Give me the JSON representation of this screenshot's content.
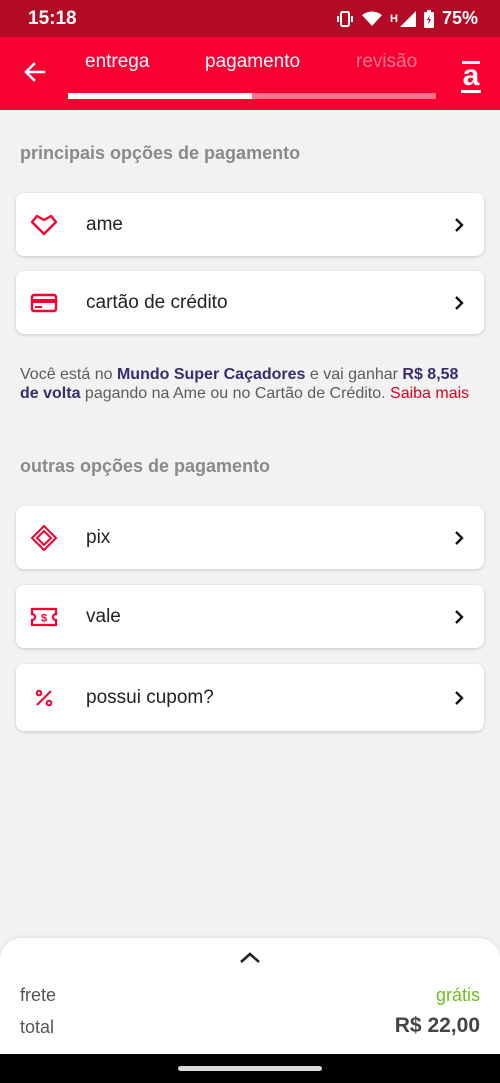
{
  "status_bar": {
    "time": "15:18",
    "network": "H",
    "battery": "75%"
  },
  "header": {
    "tabs": [
      {
        "label": "entrega"
      },
      {
        "label": "pagamento"
      },
      {
        "label": "revisão"
      }
    ],
    "progress": 0.5
  },
  "main_options": {
    "title": "principais opções de pagamento",
    "items": [
      {
        "label": "ame",
        "icon": "heart-diamond-icon"
      },
      {
        "label": "cartão de crédito",
        "icon": "credit-card-icon"
      }
    ]
  },
  "cashback": {
    "prefix": "Você está no ",
    "program": "Mundo Super Caçadores",
    "middle": " e vai ganhar ",
    "amount": "R$ 8,58 de volta",
    "suffix": " pagando na Ame ou no Cartão de Crédito. ",
    "link": "Saiba mais"
  },
  "other_options": {
    "title": "outras opções de pagamento",
    "items": [
      {
        "label": "pix",
        "icon": "pix-icon"
      },
      {
        "label": "vale",
        "icon": "voucher-icon"
      },
      {
        "label": "possui cupom?",
        "icon": "percent-icon"
      }
    ]
  },
  "summary": {
    "frete_label": "frete",
    "frete_value": "grátis",
    "total_label": "total",
    "total_value": "R$ 22,00"
  },
  "colors": {
    "brand_red": "#f80032",
    "status_red": "#b30b26",
    "green": "#6bbf1e"
  }
}
